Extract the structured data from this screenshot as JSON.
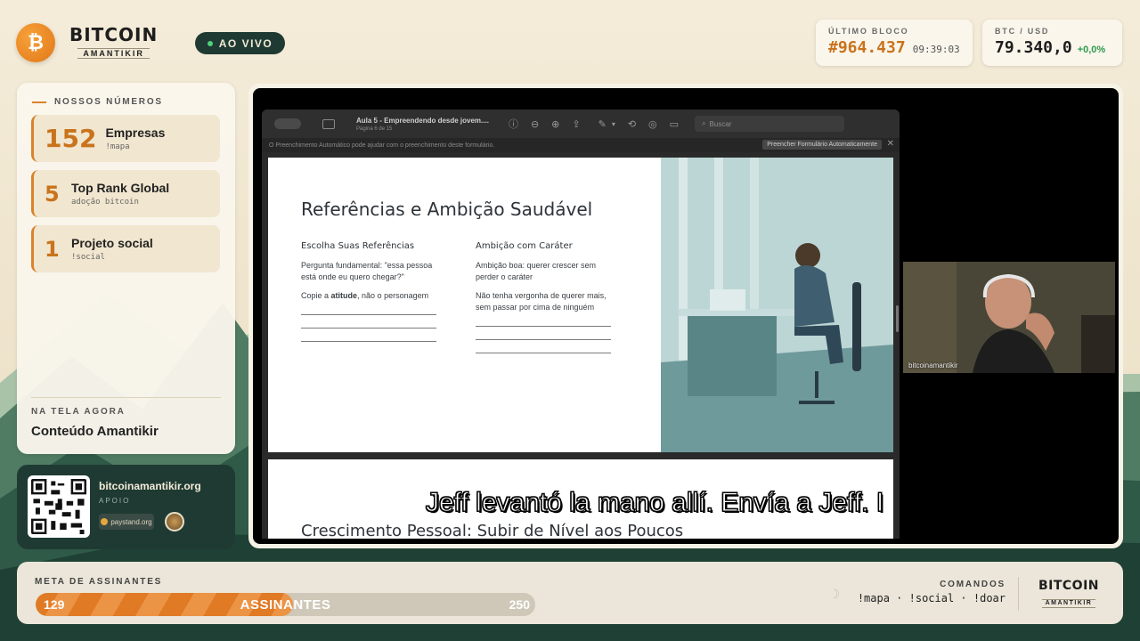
{
  "brand": {
    "logo_glyph": "₿",
    "title": "BITCOIN",
    "subtitle": "AMANTIKIR"
  },
  "live_label": "AO VIVO",
  "ticker": {
    "block_label": "ÚLTIMO BLOCO",
    "block_number": "#964.437",
    "block_time": "09:39:03",
    "price_label": "BTC / USD",
    "price": "79.340,0",
    "price_change": "+0,0%"
  },
  "stats": {
    "heading": "NOSSOS NÚMEROS",
    "items": [
      {
        "number": "152",
        "title": "Empresas",
        "command": "!mapa"
      },
      {
        "number": "5",
        "title": "Top Rank Global",
        "command": "adoção bitcoin"
      },
      {
        "number": "1",
        "title": "Projeto social",
        "command": "!social"
      }
    ],
    "now_label": "NA TELA AGORA",
    "now_value": "Conteúdo Amantikir"
  },
  "site": {
    "url": "bitcoinamantikir.org",
    "support_label": "APOIO",
    "partner": "paystand.org"
  },
  "viewer": {
    "doc_title": "Aula 5 - Empreendendo desde jovem....",
    "page_info": "Página 6 de 15",
    "search_placeholder": "Buscar",
    "autofill_notice": "O Preenchimento Automático pode ajudar com o preenchimento deste formulário.",
    "autofill_button": "Preencher Formulário Automaticamente",
    "autofill_close": "✕"
  },
  "slide": {
    "title": "Referências e Ambição Saudável",
    "left_heading": "Escolha Suas Referências",
    "left_p1": "Pergunta fundamental: \"essa pessoa está onde eu quero chegar?\"",
    "left_p2_prefix": "Copie a ",
    "left_p2_bold": "atitude",
    "left_p2_suffix": ", não o personagem",
    "right_heading": "Ambição com Caráter",
    "right_p1": "Ambição boa: querer crescer sem perder o caráter",
    "right_p2": "Não tenha vergonha de querer mais, sem passar por cima de ninguém",
    "next_title": "Crescimento Pessoal: Subir de Nível aos Poucos"
  },
  "camera": {
    "name": "bitcoinamantikir"
  },
  "caption": "Jeff levantó la mano allí. Envía a Jeff. I",
  "goal": {
    "label": "META DE ASSINANTES",
    "current": "129",
    "center_label": "ASSINANTES",
    "max": "250",
    "progress": 0.516
  },
  "commands": {
    "label": "COMANDOS",
    "value": "!mapa · !social · !doar"
  },
  "colors": {
    "accent": "#d9822b",
    "dark_green": "#1f3a33",
    "cream": "#faf6ec"
  },
  "icons": [
    "bitcoin-logo-icon",
    "sidebar-toggle-icon",
    "info-icon",
    "zoom-out-icon",
    "zoom-in-icon",
    "share-icon",
    "markup-pen-icon",
    "rotate-icon",
    "annotate-icon",
    "form-icon",
    "search-icon",
    "close-icon",
    "qr-code-icon",
    "moon-icon"
  ]
}
